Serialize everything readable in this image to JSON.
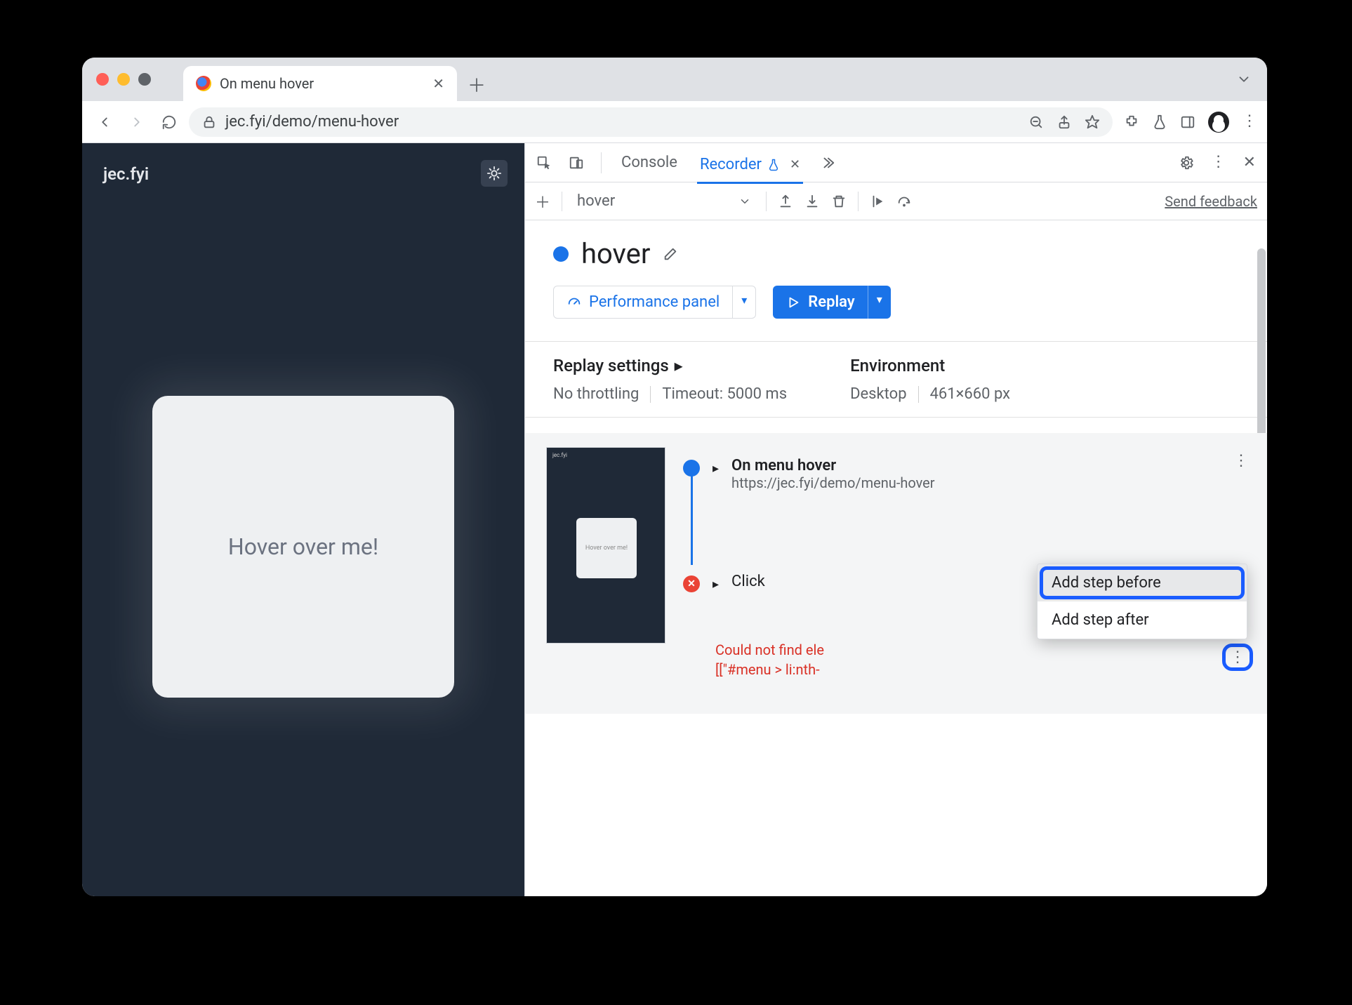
{
  "window": {
    "traffic_close": "#ff5f57",
    "traffic_min": "#febc2e",
    "traffic_max": "#5f6368"
  },
  "browser_tab": {
    "title": "On menu hover"
  },
  "omnibox": {
    "url": "jec.fyi/demo/menu-hover"
  },
  "page": {
    "site_name": "jec.fyi",
    "card_text": "Hover over me!"
  },
  "devtools": {
    "tabs": {
      "console": "Console",
      "recorder": "Recorder"
    },
    "toolbar": {
      "recording_name": "hover",
      "feedback": "Send feedback"
    },
    "recording": {
      "title": "hover",
      "performance_btn": "Performance panel",
      "replay_btn": "Replay"
    },
    "settings": {
      "replay_heading": "Replay settings",
      "throttling": "No throttling",
      "timeout": "Timeout: 5000 ms",
      "env_heading": "Environment",
      "device": "Desktop",
      "dimensions": "461×660 px"
    },
    "steps": {
      "thumb_text": "Hover over me!",
      "step1_title": "On menu hover",
      "step1_url": "https://jec.fyi/demo/menu-hover",
      "step2_title": "Click",
      "error_line1": "Could not find ele",
      "error_line2": "[[\"#menu > li:nth-"
    },
    "context_menu": {
      "add_before": "Add step before",
      "add_after": "Add step after"
    }
  }
}
